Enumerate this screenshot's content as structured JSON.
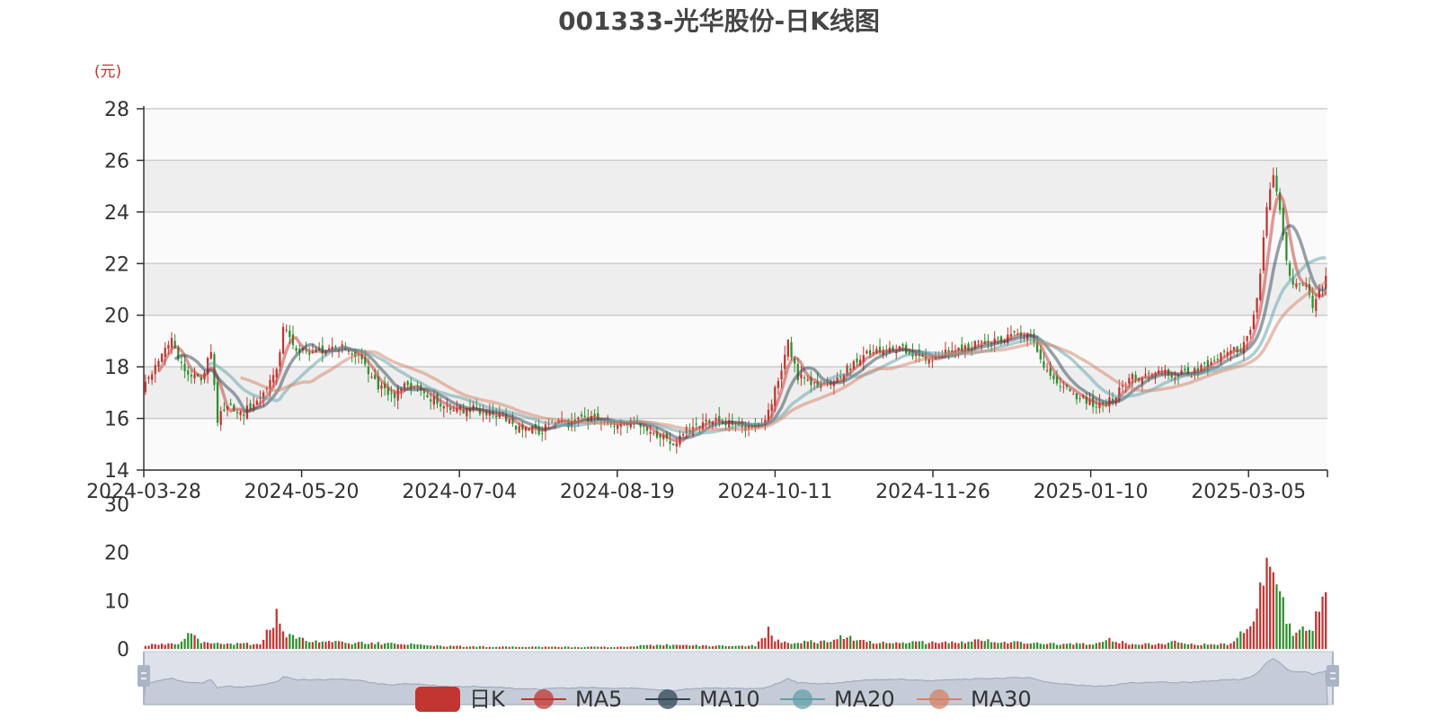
{
  "chart_data": [
    {
      "type": "candlestick",
      "title": "001333-光华股份-日K线图",
      "unit_label": "(元)",
      "ylim": [
        14,
        28
      ],
      "y_ticks": [
        14,
        16,
        18,
        20,
        22,
        24,
        26,
        28
      ],
      "x_tick_labels": [
        "2024-03-28",
        "2024-05-20",
        "2024-07-04",
        "2024-08-19",
        "2024-10-11",
        "2024-11-26",
        "2025-01-10",
        "2025-03-05"
      ],
      "grid": true,
      "banded_background": true,
      "colors": {
        "up": "#c23531",
        "down": "#2f8f2f",
        "ma5": "#c23531",
        "ma10": "#2f4554",
        "ma20": "#61a0a8",
        "ma30": "#d48265"
      },
      "close_path": [
        [
          0,
          17.3
        ],
        [
          4,
          18.2
        ],
        [
          8,
          19.0
        ],
        [
          12,
          17.8
        ],
        [
          17,
          17.5
        ],
        [
          20,
          18.6
        ],
        [
          22,
          16.0
        ],
        [
          26,
          16.5
        ],
        [
          30,
          16.2
        ],
        [
          35,
          16.9
        ],
        [
          40,
          17.8
        ],
        [
          42,
          19.6
        ],
        [
          45,
          18.8
        ],
        [
          50,
          18.5
        ],
        [
          55,
          18.6
        ],
        [
          60,
          18.8
        ],
        [
          65,
          18.4
        ],
        [
          70,
          17.4
        ],
        [
          75,
          16.8
        ],
        [
          80,
          17.3
        ],
        [
          85,
          17.0
        ],
        [
          90,
          16.5
        ],
        [
          95,
          16.3
        ],
        [
          100,
          16.4
        ],
        [
          105,
          16.2
        ],
        [
          110,
          15.9
        ],
        [
          115,
          15.6
        ],
        [
          120,
          15.5
        ],
        [
          125,
          15.9
        ],
        [
          130,
          15.8
        ],
        [
          135,
          16.0
        ],
        [
          140,
          15.8
        ],
        [
          145,
          15.9
        ],
        [
          150,
          15.9
        ],
        [
          155,
          15.5
        ],
        [
          160,
          15.0
        ],
        [
          165,
          15.5
        ],
        [
          170,
          15.9
        ],
        [
          175,
          15.9
        ],
        [
          180,
          15.8
        ],
        [
          185,
          15.6
        ],
        [
          190,
          16.2
        ],
        [
          193,
          17.5
        ],
        [
          196,
          19.0
        ],
        [
          199,
          17.6
        ],
        [
          205,
          17.3
        ],
        [
          210,
          17.5
        ],
        [
          215,
          18.0
        ],
        [
          220,
          18.5
        ],
        [
          225,
          18.7
        ],
        [
          230,
          18.7
        ],
        [
          235,
          18.4
        ],
        [
          240,
          18.3
        ],
        [
          245,
          18.6
        ],
        [
          250,
          18.8
        ],
        [
          255,
          18.9
        ],
        [
          260,
          19.0
        ],
        [
          265,
          19.3
        ],
        [
          270,
          19.2
        ],
        [
          275,
          17.8
        ],
        [
          280,
          17.2
        ],
        [
          285,
          16.8
        ],
        [
          290,
          16.5
        ],
        [
          295,
          16.8
        ],
        [
          300,
          17.6
        ],
        [
          305,
          17.6
        ],
        [
          310,
          17.8
        ],
        [
          315,
          17.7
        ],
        [
          320,
          17.8
        ],
        [
          325,
          18.1
        ],
        [
          330,
          18.6
        ],
        [
          335,
          18.8
        ],
        [
          338,
          20.0
        ],
        [
          340,
          21.5
        ],
        [
          342,
          24.3
        ],
        [
          344,
          25.5
        ],
        [
          346,
          24.2
        ],
        [
          348,
          22.0
        ],
        [
          350,
          21.3
        ],
        [
          352,
          21.2
        ],
        [
          354,
          21.1
        ],
        [
          356,
          20.4
        ],
        [
          358,
          20.8
        ],
        [
          360,
          21.6
        ]
      ],
      "volume_path": [
        [
          0,
          0.8
        ],
        [
          5,
          1.0
        ],
        [
          10,
          0.9
        ],
        [
          14,
          3.5
        ],
        [
          16,
          1.7
        ],
        [
          20,
          1.2
        ],
        [
          25,
          1.0
        ],
        [
          30,
          1.0
        ],
        [
          35,
          1.1
        ],
        [
          38,
          4.5
        ],
        [
          40,
          7.0
        ],
        [
          42,
          3.0
        ],
        [
          50,
          1.5
        ],
        [
          60,
          1.3
        ],
        [
          70,
          1.2
        ],
        [
          80,
          1.0
        ],
        [
          90,
          0.6
        ],
        [
          100,
          0.5
        ],
        [
          120,
          0.4
        ],
        [
          140,
          0.4
        ],
        [
          150,
          0.6
        ],
        [
          160,
          0.9
        ],
        [
          170,
          0.7
        ],
        [
          180,
          0.6
        ],
        [
          186,
          0.7
        ],
        [
          188,
          2.0
        ],
        [
          190,
          4.0
        ],
        [
          192,
          2.0
        ],
        [
          195,
          1.3
        ],
        [
          200,
          1.4
        ],
        [
          210,
          1.6
        ],
        [
          213,
          2.7
        ],
        [
          220,
          1.4
        ],
        [
          230,
          1.4
        ],
        [
          240,
          1.3
        ],
        [
          250,
          1.5
        ],
        [
          255,
          1.9
        ],
        [
          260,
          1.4
        ],
        [
          270,
          1.2
        ],
        [
          280,
          1.0
        ],
        [
          290,
          1.0
        ],
        [
          294,
          2.0
        ],
        [
          300,
          1.0
        ],
        [
          310,
          1.0
        ],
        [
          315,
          1.5
        ],
        [
          320,
          1.0
        ],
        [
          330,
          1.0
        ],
        [
          333,
          2.5
        ],
        [
          336,
          5.0
        ],
        [
          338,
          6.5
        ],
        [
          340,
          11.5
        ],
        [
          342,
          15.4
        ],
        [
          344,
          13.5
        ],
        [
          346,
          12.8
        ],
        [
          348,
          6.0
        ],
        [
          350,
          3.5
        ],
        [
          352,
          3.8
        ],
        [
          354,
          4.0
        ],
        [
          356,
          3.5
        ],
        [
          358,
          9.5
        ],
        [
          360,
          9.5
        ]
      ],
      "ma_smoothing": [
        5,
        10,
        20,
        30
      ]
    },
    {
      "type": "bar",
      "label": "volume",
      "ylim": [
        0,
        30
      ],
      "y_ticks": [
        0,
        10,
        20,
        30
      ]
    }
  ],
  "legend": {
    "position": "bottom-center",
    "items": [
      {
        "label": "日K",
        "color": "#c23531",
        "icon": "rounded-rect"
      },
      {
        "label": "MA5",
        "color": "#c23531",
        "icon": "circle-line"
      },
      {
        "label": "MA10",
        "color": "#2f4554",
        "icon": "circle-line"
      },
      {
        "label": "MA20",
        "color": "#61a0a8",
        "icon": "circle-line"
      },
      {
        "label": "MA30",
        "color": "#d48265",
        "icon": "circle-line"
      }
    ]
  },
  "datazoom": {
    "start_percent": 0,
    "end_percent": 100
  }
}
